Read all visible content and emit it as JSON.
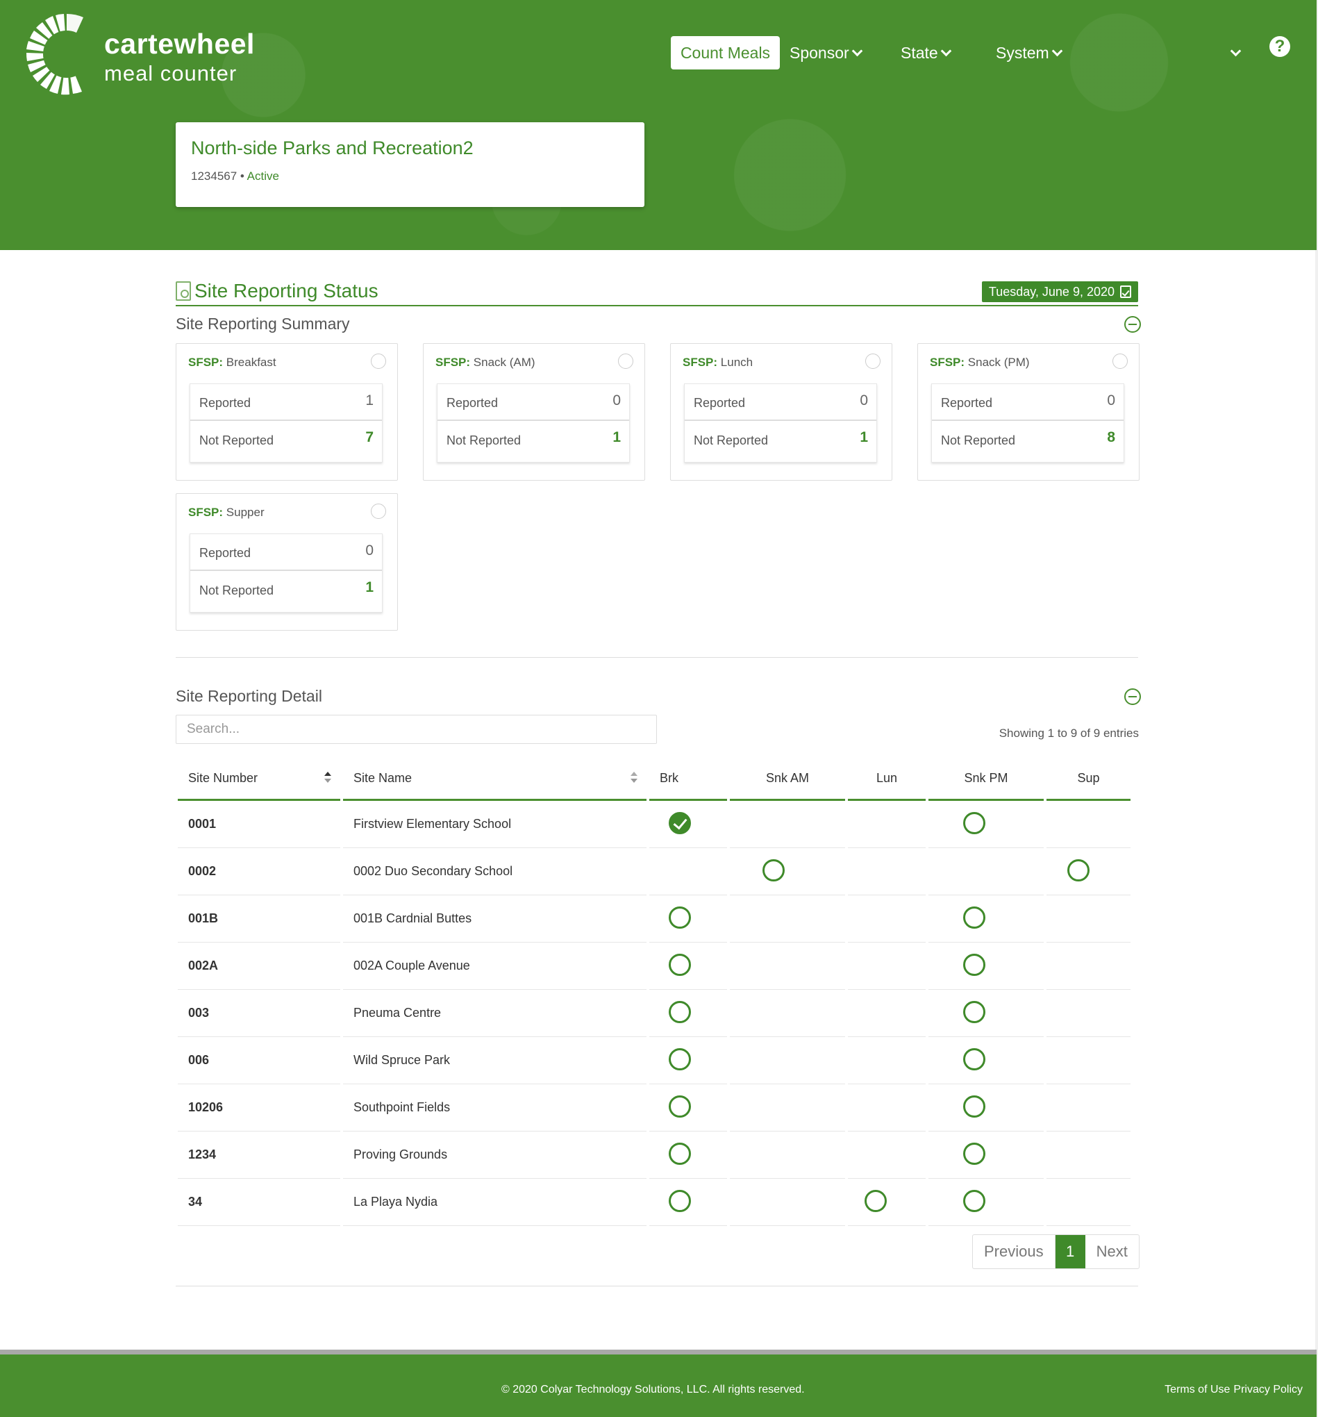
{
  "brand": {
    "name": "cartewheel",
    "sub": "meal counter"
  },
  "nav": {
    "count_meals": "Count Meals",
    "sponsor": "Sponsor",
    "state": "State",
    "system": "System"
  },
  "sponsor": {
    "name": "North-side Parks and Recreation2",
    "id": "1234567",
    "separator": "•",
    "status": "Active"
  },
  "page": {
    "title": "Site Reporting Status",
    "date": "Tuesday, June 9, 2020",
    "summary_title": "Site Reporting Summary",
    "detail_title": "Site Reporting Detail"
  },
  "meals": [
    {
      "program": "SFSP:",
      "name": "Breakfast",
      "reported_label": "Reported",
      "reported": "1",
      "not_reported_label": "Not Reported",
      "not_reported": "7"
    },
    {
      "program": "SFSP:",
      "name": "Snack (AM)",
      "reported_label": "Reported",
      "reported": "0",
      "not_reported_label": "Not Reported",
      "not_reported": "1"
    },
    {
      "program": "SFSP:",
      "name": "Lunch",
      "reported_label": "Reported",
      "reported": "0",
      "not_reported_label": "Not Reported",
      "not_reported": "1"
    },
    {
      "program": "SFSP:",
      "name": "Snack (PM)",
      "reported_label": "Reported",
      "reported": "0",
      "not_reported_label": "Not Reported",
      "not_reported": "8"
    },
    {
      "program": "SFSP:",
      "name": "Supper",
      "reported_label": "Reported",
      "reported": "0",
      "not_reported_label": "Not Reported",
      "not_reported": "1"
    }
  ],
  "search": {
    "placeholder": "Search..."
  },
  "showing": "Showing 1 to 9 of 9 entries",
  "table": {
    "headers": [
      "Site Number",
      "Site Name",
      "Brk",
      "Snk AM",
      "Lun",
      "Snk PM",
      "Sup"
    ],
    "rows": [
      {
        "number": "0001",
        "name": "Firstview Elementary School",
        "brk": "checked",
        "snk_am": "",
        "lun": "",
        "snk_pm": "open",
        "sup": ""
      },
      {
        "number": "0002",
        "name": "0002 Duo Secondary School",
        "brk": "",
        "snk_am": "open",
        "lun": "",
        "snk_pm": "",
        "sup": "open"
      },
      {
        "number": "001B",
        "name": "001B Cardnial Buttes",
        "brk": "open",
        "snk_am": "",
        "lun": "",
        "snk_pm": "open",
        "sup": ""
      },
      {
        "number": "002A",
        "name": "002A Couple Avenue",
        "brk": "open",
        "snk_am": "",
        "lun": "",
        "snk_pm": "open",
        "sup": ""
      },
      {
        "number": "003",
        "name": "Pneuma Centre",
        "brk": "open",
        "snk_am": "",
        "lun": "",
        "snk_pm": "open",
        "sup": ""
      },
      {
        "number": "006",
        "name": "Wild Spruce Park",
        "brk": "open",
        "snk_am": "",
        "lun": "",
        "snk_pm": "open",
        "sup": ""
      },
      {
        "number": "10206",
        "name": "Southpoint Fields",
        "brk": "open",
        "snk_am": "",
        "lun": "",
        "snk_pm": "open",
        "sup": ""
      },
      {
        "number": "1234",
        "name": "Proving Grounds",
        "brk": "open",
        "snk_am": "",
        "lun": "",
        "snk_pm": "open",
        "sup": ""
      },
      {
        "number": "34",
        "name": "La Playa Nydia",
        "brk": "open",
        "snk_am": "",
        "lun": "open",
        "snk_pm": "open",
        "sup": ""
      }
    ]
  },
  "pagination": {
    "previous": "Previous",
    "current": "1",
    "next": "Next"
  },
  "footer": {
    "copyright": "© 2020 Colyar Technology Solutions, LLC. All rights reserved.",
    "terms": "Terms of Use",
    "privacy": "Privacy Policy"
  },
  "colors": {
    "brand_green": "#4a8f2f",
    "accent_green": "#3f8a2a"
  }
}
